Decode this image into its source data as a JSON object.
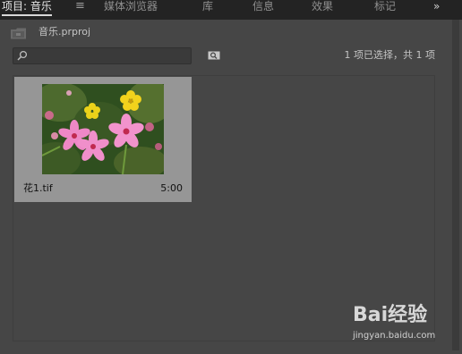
{
  "tabs": [
    {
      "label": "项目: 音乐",
      "active": true
    },
    {
      "label": "媒体浏览器",
      "active": false
    },
    {
      "label": "库",
      "active": false
    },
    {
      "label": "信息",
      "active": false
    },
    {
      "label": "效果",
      "active": false
    },
    {
      "label": "标记",
      "active": false
    }
  ],
  "tab_menu_glyph": "≡",
  "tab_overflow_glyph": "»",
  "project": {
    "name": "音乐.prproj",
    "icon": "project-folder-icon"
  },
  "search": {
    "placeholder": "",
    "value": "",
    "icon": "search-icon"
  },
  "toolbar": {
    "new_bin_icon": "new-bin-icon",
    "selection_status": "1 项已选择，共 1 项"
  },
  "clips": [
    {
      "name": "花1.tif",
      "duration": "5:00",
      "selected": true
    }
  ],
  "watermark": {
    "logo": "Bai经验",
    "url": "jingyan.baidu.com"
  },
  "colors": {
    "panel_bg": "#464646",
    "tab_bg": "#232323",
    "selected_clip_bg": "#969696",
    "active_tab_underline": "#d9d9d9"
  }
}
